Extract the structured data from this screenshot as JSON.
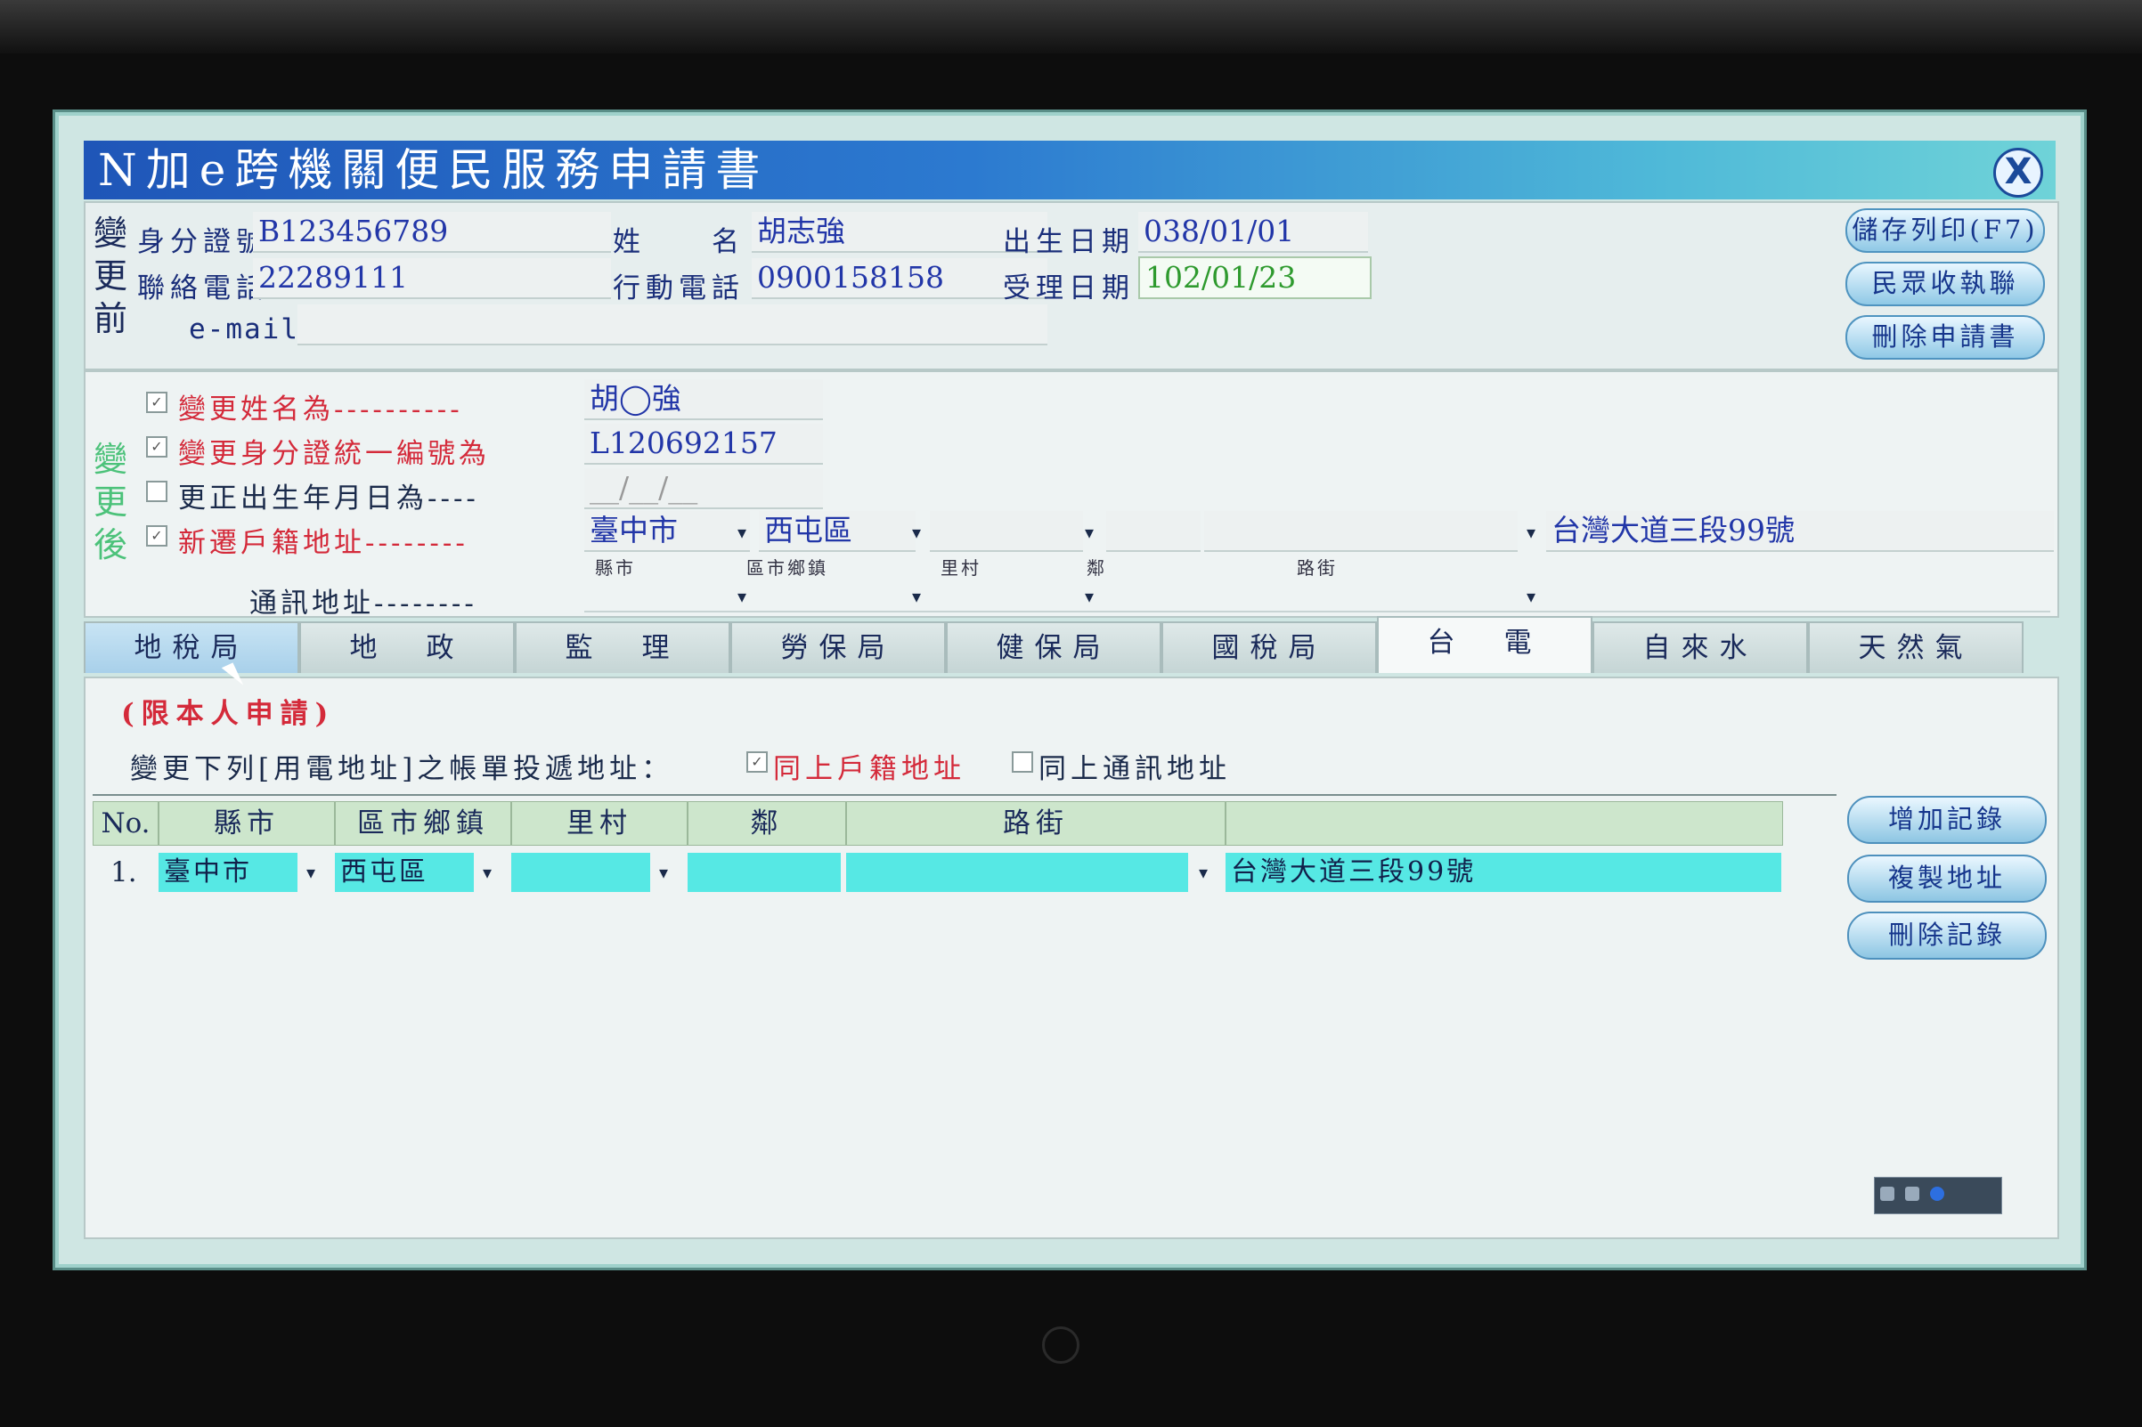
{
  "window": {
    "title": "N加e跨機關便民服務申請書",
    "close_label": "X"
  },
  "before": {
    "section_label": [
      "變",
      "更",
      "前"
    ],
    "id_label": "身分證號",
    "id_value": "B123456789",
    "name_label": "姓　　名",
    "name_value": "胡志強",
    "birth_label": "出生日期",
    "birth_value": "038/01/01",
    "phone_label": "聯絡電話",
    "phone_value": "22289111",
    "mobile_label": "行動電話",
    "mobile_value": "0900158158",
    "accept_label": "受理日期",
    "accept_value": "102/01/23",
    "email_label": "e-mail",
    "email_value": ""
  },
  "side_buttons": {
    "save_print": "儲存列印(F7)",
    "receipt": "民眾收執聯",
    "delete_app": "刪除申請書"
  },
  "after": {
    "section_label": [
      "變",
      "更",
      "後"
    ],
    "change_name": {
      "checked": true,
      "label": "變更姓名為----------",
      "value": "胡◯強"
    },
    "change_id": {
      "checked": true,
      "label": "變更身分證統一編號為",
      "value": "L120692157"
    },
    "fix_birth": {
      "checked": false,
      "label": "更正出生年月日為----",
      "value": "__/__/__"
    },
    "new_address": {
      "checked": true,
      "label": "新遷戶籍地址--------",
      "city": "臺中市",
      "district": "西屯區",
      "village": "",
      "road": "",
      "detail": "台灣大道三段99號"
    },
    "address_sublabels": {
      "city": "縣市",
      "district": "區市鄉鎮",
      "village": "里村",
      "neighbor": "鄰",
      "road": "路街"
    },
    "mail_address": {
      "label": "通訊地址--------"
    }
  },
  "tabs": [
    "地稅局",
    "地　政",
    "監　理",
    "勞保局",
    "健保局",
    "國稅局",
    "台　電",
    "自來水",
    "天然氣"
  ],
  "active_tab": 6,
  "body": {
    "restriction": "(限本人申請)",
    "instruction": "變更下列[用電地址]之帳單投遞地址：",
    "opt_same_household": {
      "checked": true,
      "label": "同上戶籍地址"
    },
    "opt_same_mail": {
      "checked": false,
      "label": "同上通訊地址"
    },
    "columns": [
      "No.",
      "縣市",
      "區市鄉鎮",
      "里村",
      "鄰",
      "路街",
      ""
    ],
    "rows": [
      {
        "no": "1.",
        "city": "臺中市",
        "district": "西屯區",
        "village": "",
        "neighbor": "",
        "road": "",
        "detail": "台灣大道三段99號"
      }
    ],
    "buttons": {
      "add": "增加記錄",
      "copy": "複製地址",
      "delete": "刪除記錄"
    }
  }
}
